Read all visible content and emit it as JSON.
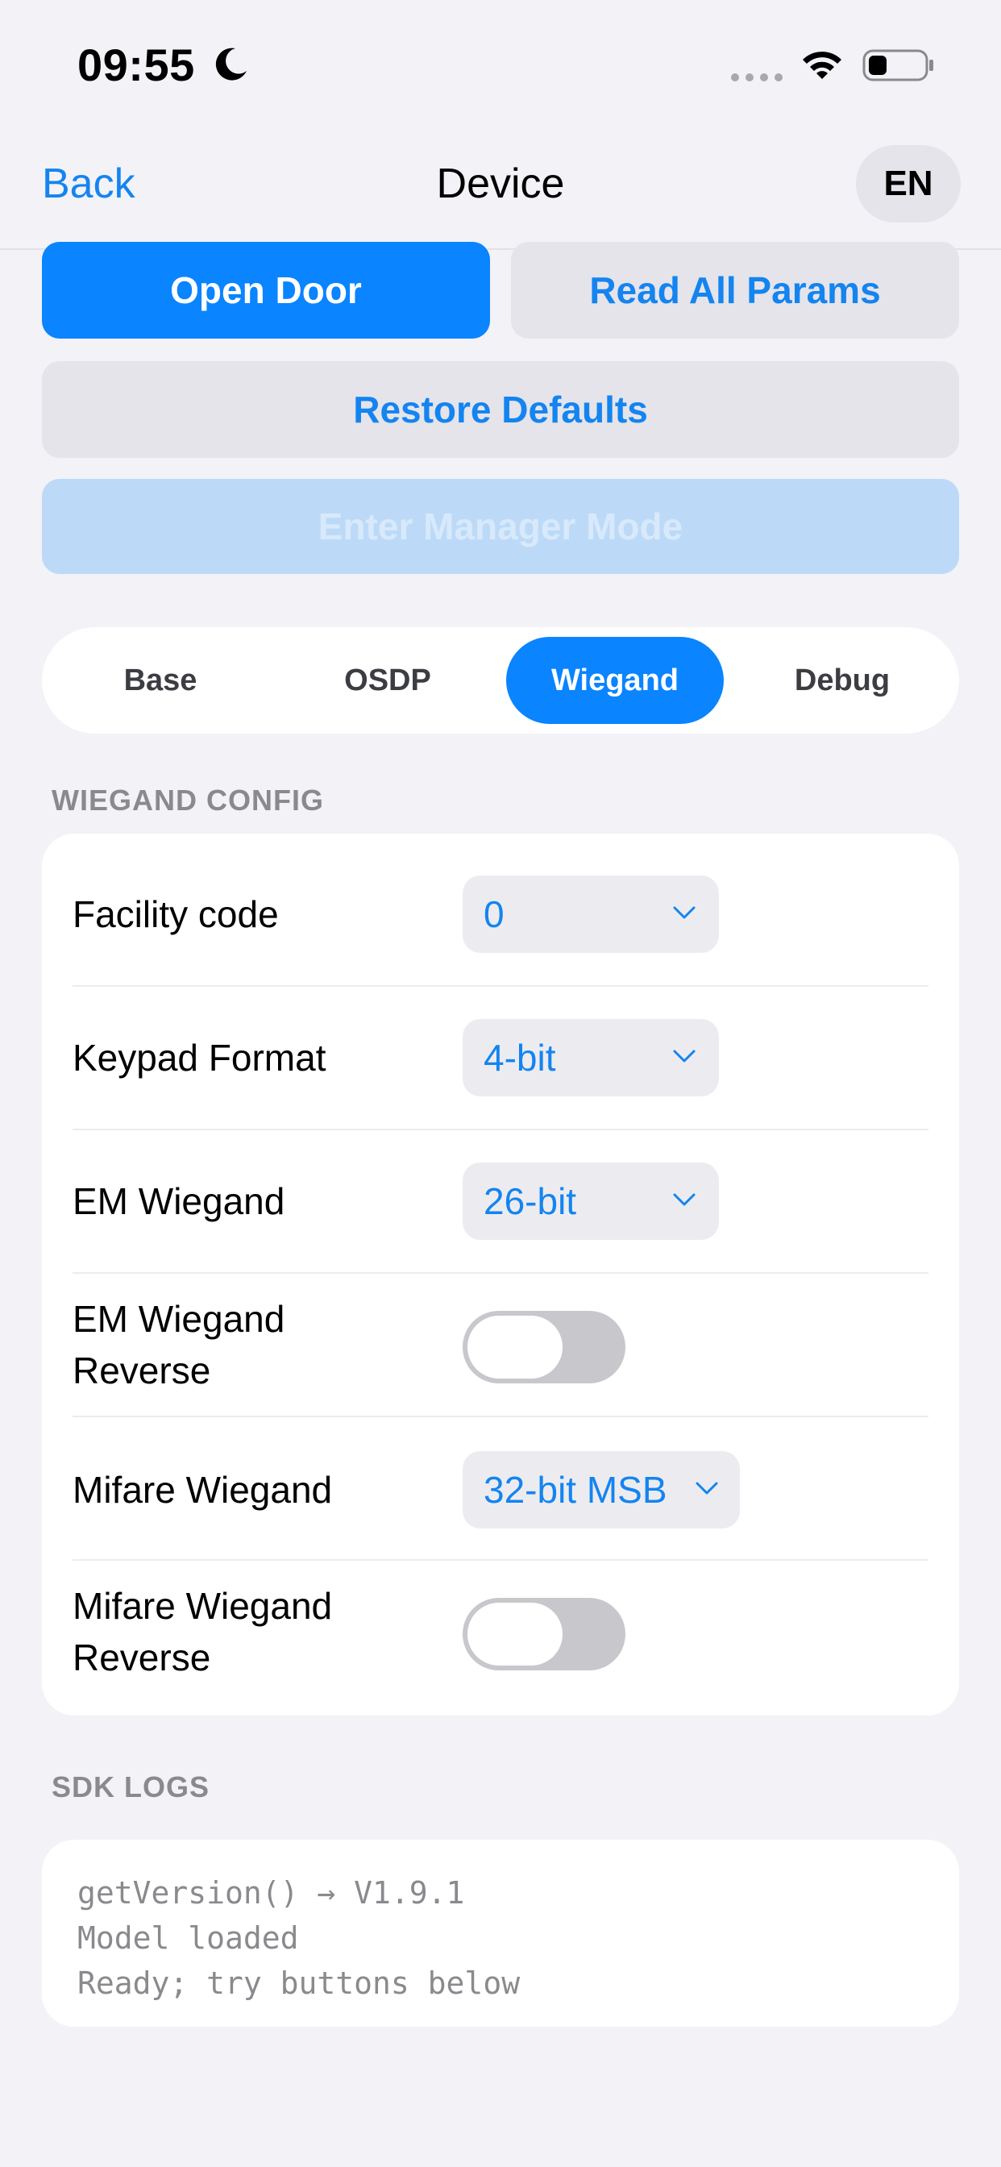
{
  "status_bar": {
    "time": "09:55",
    "icons": [
      "moon-icon",
      "cellular-dots-icon",
      "wifi-icon",
      "battery-icon"
    ]
  },
  "nav": {
    "back_label": "Back",
    "title": "Device",
    "lang_label": "EN"
  },
  "actions": {
    "open_door": "Open Door",
    "read_all": "Read All Params",
    "restore": "Restore Defaults",
    "manager": "Enter Manager Mode"
  },
  "tabs": [
    {
      "label": "Base",
      "selected": false
    },
    {
      "label": "OSDP",
      "selected": false
    },
    {
      "label": "Wiegand",
      "selected": true
    },
    {
      "label": "Debug",
      "selected": false
    }
  ],
  "wiegand": {
    "header": "WIEGAND CONFIG",
    "facility_code": {
      "label": "Facility code",
      "value": "0"
    },
    "keypad_format": {
      "label": "Keypad Format",
      "value": "4-bit"
    },
    "em_wiegand": {
      "label": "EM Wiegand",
      "value": "26-bit"
    },
    "em_reverse": {
      "label_line1": "EM Wiegand",
      "label_line2": "Reverse",
      "on": false
    },
    "mifare_wiegand": {
      "label": "Mifare Wiegand",
      "value": "32-bit MSB"
    },
    "mifare_reverse": {
      "label_line1": "Mifare Wiegand",
      "label_line2": "Reverse",
      "on": false
    }
  },
  "sdk_logs": {
    "header": "SDK LOGS",
    "lines": [
      "getVersion() → V1.9.1",
      "Model loaded",
      "Ready; try buttons below"
    ]
  },
  "colors": {
    "accent": "#0a84ff",
    "link": "#1484f0",
    "background": "#f2f2f7",
    "card": "#ffffff",
    "secondary_button": "#e4e4ea",
    "disabled_button": "#bcdaf8"
  }
}
